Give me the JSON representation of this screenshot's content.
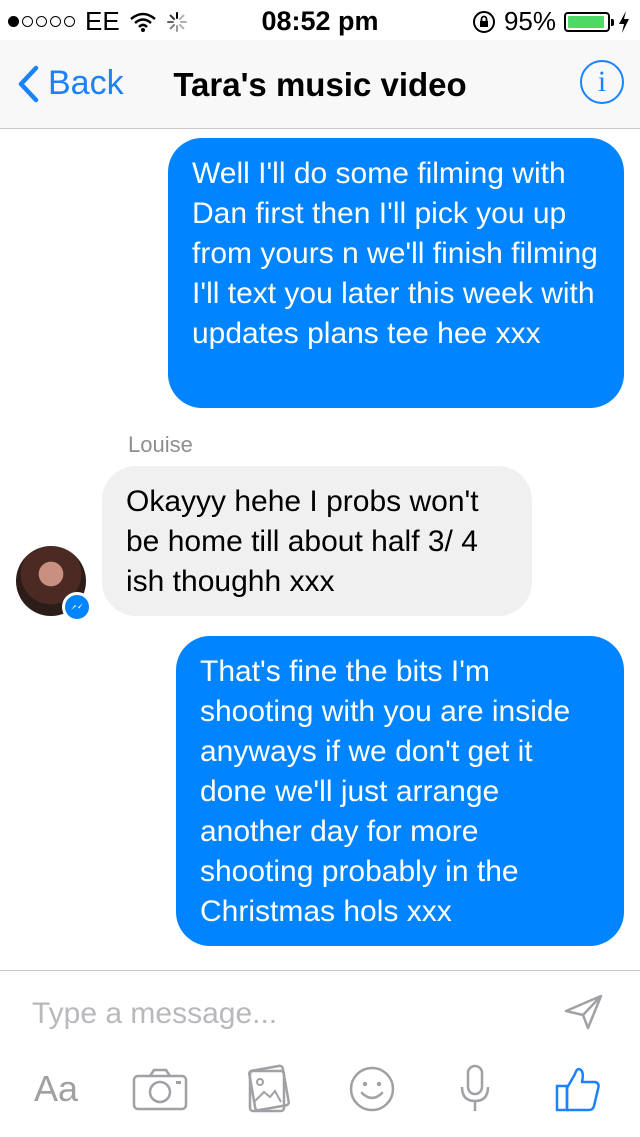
{
  "status": {
    "carrier": "EE",
    "time": "08:52 pm",
    "battery_percent": "95%",
    "battery_level": 0.95
  },
  "nav": {
    "back_label": "Back",
    "title": "Tara's music video",
    "info_label": "i"
  },
  "messages": [
    {
      "direction": "sent",
      "text": "Well I'll do some filming with Dan first then I'll pick you up from yours n we'll finish filming I'll text you later this week with updates plans tee hee xxx"
    },
    {
      "direction": "received",
      "sender": "Louise",
      "text": "Okayyy hehe I probs won't be home till about half 3/ 4 ish thoughh xxx"
    },
    {
      "direction": "sent",
      "text": "That's fine the bits I'm shooting with you are inside anyways if we don't get it done we'll just arrange another day for more shooting probably in the Christmas hols xxx"
    }
  ],
  "composer": {
    "placeholder": "Type a message...",
    "text_tool_label": "Aa"
  },
  "icons": [
    "chevron-left-icon",
    "info-icon",
    "messenger-icon",
    "send-icon",
    "camera-icon",
    "gallery-icon",
    "emoji-icon",
    "microphone-icon",
    "like-icon"
  ],
  "colors": {
    "accent": "#1a82fb",
    "sent_bubble": "#0084ff",
    "received_bubble": "#f1f0f0",
    "battery": "#4cd964"
  }
}
